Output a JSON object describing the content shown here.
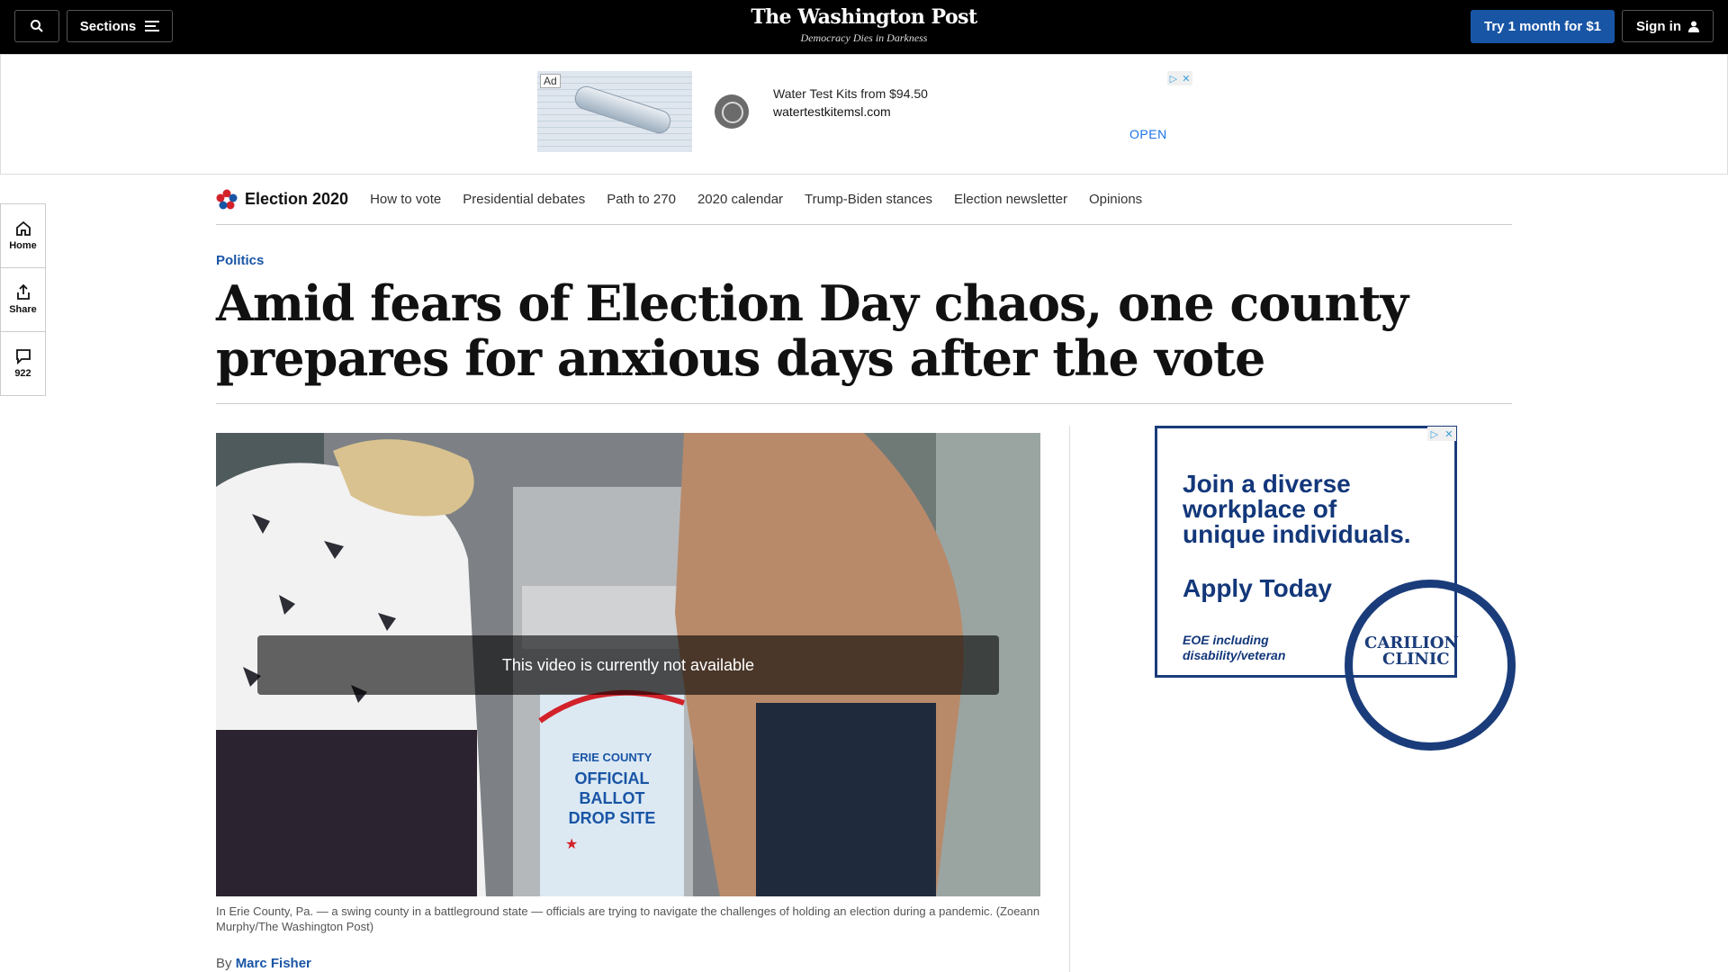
{
  "header": {
    "sections_label": "Sections",
    "logo": "The Washington Post",
    "tagline": "Democracy Dies in Darkness",
    "subscribe_label": "Try 1 month for $1",
    "signin_label": "Sign in"
  },
  "top_ad": {
    "ad_label": "Ad",
    "headline": "Water Test Kits from $94.50",
    "url": "watertestkitemsl.com",
    "cta": "OPEN"
  },
  "rail": {
    "home_label": "Home",
    "share_label": "Share",
    "comments_count": "922"
  },
  "election_nav": {
    "brand": "Election 2020",
    "links": [
      "How to vote",
      "Presidential debates",
      "Path to 270",
      "2020 calendar",
      "Trump-Biden stances",
      "Election newsletter",
      "Opinions"
    ]
  },
  "article": {
    "kicker": "Politics",
    "headline": "Amid fears of Election Day chaos, one county prepares for anxious days after the vote",
    "video_message": "This video is currently not available",
    "sign_lines": [
      "ERIE COUNTY",
      "OFFICIAL",
      "BALLOT",
      "DROP SITE"
    ],
    "caption": "In Erie County, Pa. — a swing county in a battleground state — officials are trying to navigate the challenges of holding an election during a pandemic. (Zoeann Murphy/The Washington Post)",
    "byline_prefix": "By",
    "author": "Marc Fisher"
  },
  "side_ad": {
    "copy_lines": [
      "Join a diverse",
      "workplace of",
      "unique individuals."
    ],
    "cta": "Apply Today",
    "eoe_lines": [
      "EOE including",
      "disability/veteran"
    ],
    "logo_lines": [
      "CARILION",
      "CLINIC"
    ]
  },
  "colors": {
    "brand_blue": "#1955a5",
    "ad_navy": "#13377a"
  }
}
